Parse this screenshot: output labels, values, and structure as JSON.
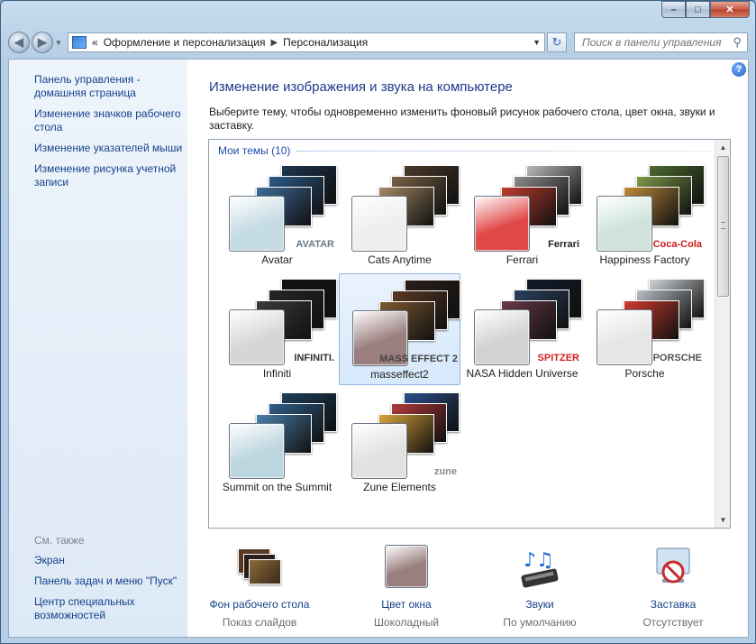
{
  "window": {
    "caption_buttons": {
      "minimize": "–",
      "maximize": "□",
      "close": "✕"
    }
  },
  "nav": {
    "back_icon": "back-arrow-icon",
    "forward_icon": "forward-arrow-icon",
    "address_prefix": "«",
    "breadcrumb": [
      "Оформление и персонализация",
      "Персонализация"
    ],
    "search_placeholder": "Поиск в панели управления"
  },
  "sidebar": {
    "links": [
      "Панель управления - домашняя страница",
      "Изменение значков рабочего стола",
      "Изменение указателей мыши",
      "Изменение рисунка учетной записи"
    ],
    "see_also_title": "См. также",
    "see_also": [
      "Экран",
      "Панель задач и меню \"Пуск\"",
      "Центр специальных возможностей"
    ]
  },
  "main": {
    "help_label": "?",
    "title": "Изменение изображения и звука на компьютере",
    "description": "Выберите тему, чтобы одновременно изменить фоновый рисунок рабочего стола, цвет окна, звуки и заставку.",
    "group_label": "Мои темы (10)",
    "themes": [
      {
        "label": "Avatar",
        "brand": "AVATAR",
        "swatch": "#c6dce4",
        "brand_color": "#6a7a86",
        "cards": [
          "#1d3450",
          "#2a5a88",
          "#3e6c9b"
        ],
        "selected": false
      },
      {
        "label": "Cats Anytime",
        "brand": "",
        "swatch": "#eeeeee",
        "brand_color": "#555555",
        "cards": [
          "#4a3a2a",
          "#7a6246",
          "#a48a64"
        ],
        "selected": false
      },
      {
        "label": "Ferrari",
        "brand": "Ferrari",
        "swatch": "#e04848",
        "brand_color": "#222222",
        "cards": [
          "#b9b9b9",
          "#8c8c8c",
          "#c23b2e"
        ],
        "selected": false
      },
      {
        "label": "Happiness Factory",
        "brand": "Coca-Cola",
        "swatch": "#cfe3dc",
        "brand_color": "#cc1b1b",
        "cards": [
          "#4d6a2e",
          "#7e9a48",
          "#c08a3a"
        ],
        "selected": false
      },
      {
        "label": "Infiniti",
        "brand": "INFINITI.",
        "swatch": "#d6d6d6",
        "brand_color": "#333333",
        "cards": [
          "#121212",
          "#262626",
          "#3c3c3c"
        ],
        "selected": false
      },
      {
        "label": "masseffect2",
        "brand": "MASS EFFECT 2",
        "swatch": "#9b7f7f",
        "brand_color": "#444444",
        "cards": [
          "#2a1e18",
          "#5b3a22",
          "#7e5a32"
        ],
        "selected": true
      },
      {
        "label": "NASA Hidden Universe",
        "brand": "SPITZER",
        "swatch": "#d2d2d2",
        "brand_color": "#d32020",
        "cards": [
          "#0e1a2a",
          "#2a4060",
          "#6a3a48"
        ],
        "selected": false
      },
      {
        "label": "Porsche",
        "brand": "PORSCHE",
        "swatch": "#e6e6e6",
        "brand_color": "#555555",
        "cards": [
          "#cfd4d8",
          "#b8bfc6",
          "#d23a30"
        ],
        "selected": false
      },
      {
        "label": "Summit on the Summit",
        "brand": "",
        "swatch": "#bcd6e0",
        "brand_color": "#333333",
        "cards": [
          "#1e3d5c",
          "#2f5f8a",
          "#4a7fae"
        ],
        "selected": false
      },
      {
        "label": "Zune Elements",
        "brand": "zune",
        "swatch": "#e2e2e2",
        "brand_color": "#8a8a8a",
        "cards": [
          "#2b4f8a",
          "#b33a3a",
          "#d9a53a"
        ],
        "selected": false
      }
    ]
  },
  "bottom": [
    {
      "icon": "desktop-background-icon",
      "label": "Фон рабочего стола",
      "value": "Показ слайдов"
    },
    {
      "icon": "window-color-icon",
      "label": "Цвет окна",
      "value": "Шоколадный",
      "swatch": "#9b7f7f"
    },
    {
      "icon": "sounds-icon",
      "label": "Звуки",
      "value": "По умолчанию"
    },
    {
      "icon": "screensaver-icon",
      "label": "Заставка",
      "value": "Отсутствует"
    }
  ]
}
